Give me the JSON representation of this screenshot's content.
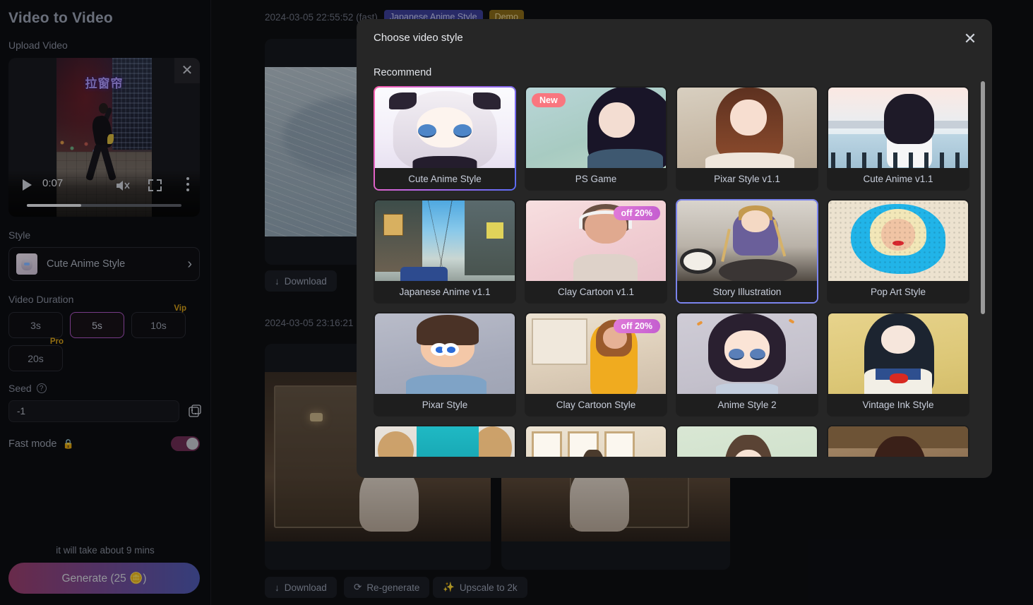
{
  "sidebar": {
    "title": "Video to Video",
    "upload_label": "Upload Video",
    "video": {
      "overlay_text": "拉窗帘",
      "time": "0:07",
      "close_icon": "close-icon"
    },
    "style_label": "Style",
    "style_value": "Cute Anime Style",
    "duration_label": "Video Duration",
    "durations": [
      {
        "label": "3s",
        "tag": "",
        "selected": false
      },
      {
        "label": "5s",
        "tag": "",
        "selected": true
      },
      {
        "label": "10s",
        "tag": "Vip",
        "selected": false
      },
      {
        "label": "20s",
        "tag": "Pro",
        "selected": false
      }
    ],
    "seed_label": "Seed",
    "seed_value": "-1",
    "seed_placeholder": "-1",
    "fast_mode_label": "Fast mode",
    "fast_mode_lock": "🔒",
    "hint": "it will take about 9 mins",
    "generate_label": "Generate (25 🪙)"
  },
  "main": {
    "result_top": {
      "timestamp": "2024-03-05 22:55:52 (fast)",
      "style_pill": "Japanese Anime Style",
      "demo_pill": "Demo",
      "download_label": "Download"
    },
    "result_bottom": {
      "timestamp": "2024-03-05 23:16:21",
      "download_label": "Download",
      "regenerate_label": "Re-generate",
      "upscale_label": "Upscale to 2k"
    }
  },
  "modal": {
    "title": "Choose video style",
    "close_icon": "close-icon",
    "group_title": "Recommend",
    "colors": {
      "selected_border_from": "#ff5fae",
      "selected_border_to": "#5b6cf5",
      "hover_border": "#7b84ee",
      "badge_new": "#f9767f",
      "badge_off": "#c45ed0",
      "modal_bg": "#262626"
    },
    "styles": [
      {
        "label": "Cute Anime Style",
        "badge": "",
        "state": "selected",
        "art": "a-cute"
      },
      {
        "label": "PS Game",
        "badge": "New",
        "badge_type": "new",
        "state": "",
        "art": "a-ps"
      },
      {
        "label": "Pixar Style v1.1",
        "badge": "",
        "state": "",
        "art": "a-pixar"
      },
      {
        "label": "Cute Anime v1.1",
        "badge": "",
        "state": "",
        "art": "a-cutev"
      },
      {
        "label": "Japanese Anime v1.1",
        "badge": "",
        "state": "",
        "art": "a-street"
      },
      {
        "label": "Clay Cartoon v1.1",
        "badge": "off 20%",
        "badge_type": "off",
        "state": "",
        "art": "a-clay1"
      },
      {
        "label": "Story Illustration",
        "badge": "",
        "state": "hover",
        "art": "a-story"
      },
      {
        "label": "Pop Art Style",
        "badge": "",
        "state": "",
        "art": "a-pop"
      },
      {
        "label": "Pixar Style",
        "badge": "",
        "state": "",
        "art": "a-pixar2"
      },
      {
        "label": "Clay Cartoon Style",
        "badge": "off 20%",
        "badge_type": "off",
        "state": "",
        "art": "a-clay2"
      },
      {
        "label": "Anime Style 2",
        "badge": "",
        "state": "",
        "art": "a-anime2"
      },
      {
        "label": "Vintage Ink Style",
        "badge": "",
        "state": "",
        "art": "a-vintage"
      },
      {
        "label": "",
        "badge": "",
        "state": "",
        "art": "a-kimono"
      },
      {
        "label": "",
        "badge": "",
        "state": "",
        "art": "a-window"
      },
      {
        "label": "",
        "badge": "",
        "state": "",
        "art": "a-soft"
      },
      {
        "label": "",
        "badge": "",
        "state": "",
        "art": "a-dark"
      }
    ]
  }
}
